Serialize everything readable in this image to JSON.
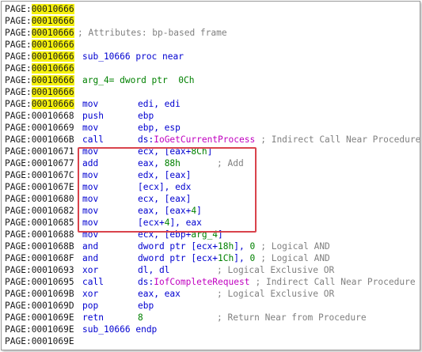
{
  "listing": {
    "rows": [
      {
        "prefix": "PAGE:",
        "addr": "00010666",
        "hl": true
      },
      {
        "prefix": "PAGE:",
        "addr": "00010666",
        "hl": true
      },
      {
        "prefix": "PAGE:",
        "addr": "00010666",
        "hl": true,
        "c": "; Attributes: bp-based frame",
        "ccolor": "gray",
        "cpos": "a"
      },
      {
        "prefix": "PAGE:",
        "addr": "00010666",
        "hl": true
      },
      {
        "prefix": "PAGE:",
        "addr": "00010666",
        "hl": true,
        "a": "sub_10666 proc near",
        "acolor": "blue"
      },
      {
        "prefix": "PAGE:",
        "addr": "00010666",
        "hl": true
      },
      {
        "prefix": "PAGE:",
        "addr": "00010666",
        "hl": true,
        "a": "arg_4= dword ptr  0Ch",
        "acolor": "green"
      },
      {
        "prefix": "PAGE:",
        "addr": "00010666",
        "hl": true
      },
      {
        "prefix": "PAGE:",
        "addr": "00010666",
        "hl": true,
        "a": "mov",
        "b": "edi, edi"
      },
      {
        "prefix": "PAGE:",
        "addr": "00010668",
        "a": "push",
        "b": "ebp"
      },
      {
        "prefix": "PAGE:",
        "addr": "00010669",
        "a": "mov",
        "b": "ebp, esp"
      },
      {
        "prefix": "PAGE:",
        "addr": "0001066B",
        "a": "call",
        "b": "ds:",
        "b2": "IoGetCurrentProcess",
        "b2color": "magenta",
        "c": " ; Indirect Call Near Procedure"
      },
      {
        "prefix": "PAGE:",
        "addr": "00010671",
        "a": "mov",
        "b": "ecx, [eax+",
        "b2": "8Ch",
        "b2color": "green",
        "b3": "]"
      },
      {
        "prefix": "PAGE:",
        "addr": "00010677",
        "a": "add",
        "b": "eax, ",
        "b2": "88h",
        "b2color": "green",
        "c": "; Add",
        "cgap": true
      },
      {
        "prefix": "PAGE:",
        "addr": "0001067C",
        "a": "mov",
        "b": "edx, [eax]"
      },
      {
        "prefix": "PAGE:",
        "addr": "0001067E",
        "a": "mov",
        "b": "[ecx], edx"
      },
      {
        "prefix": "PAGE:",
        "addr": "00010680",
        "a": "mov",
        "b": "ecx, [eax]"
      },
      {
        "prefix": "PAGE:",
        "addr": "00010682",
        "a": "mov",
        "b": "eax, [eax+",
        "b2": "4",
        "b2color": "green",
        "b3": "]"
      },
      {
        "prefix": "PAGE:",
        "addr": "00010685",
        "a": "mov",
        "b": "[ecx+",
        "b2": "4",
        "b2color": "green",
        "b3": "], eax"
      },
      {
        "prefix": "PAGE:",
        "addr": "00010688",
        "a": "mov",
        "b": "ecx, [ebp+",
        "b2": "arg_4",
        "b2color": "green",
        "b3": "]"
      },
      {
        "prefix": "PAGE:",
        "addr": "0001068B",
        "a": "and",
        "b": "dword ptr [ecx+",
        "b2": "18h",
        "b2color": "green",
        "b3": "], ",
        "b4": "0",
        "b4color": "green",
        "c": " ; Logical AND"
      },
      {
        "prefix": "PAGE:",
        "addr": "0001068F",
        "a": "and",
        "b": "dword ptr [ecx+",
        "b2": "1Ch",
        "b2color": "green",
        "b3": "], ",
        "b4": "0",
        "b4color": "green",
        "c": " ; Logical AND"
      },
      {
        "prefix": "PAGE:",
        "addr": "00010693",
        "a": "xor",
        "b": "dl, dl",
        "c": "; Logical Exclusive OR",
        "cgap": true
      },
      {
        "prefix": "PAGE:",
        "addr": "00010695",
        "a": "call",
        "b": "ds:",
        "b2": "IofCompleteRequest",
        "b2color": "magenta",
        "c": " ; Indirect Call Near Procedure"
      },
      {
        "prefix": "PAGE:",
        "addr": "0001069B",
        "a": "xor",
        "b": "eax, eax",
        "c": "; Logical Exclusive OR",
        "cgap": true
      },
      {
        "prefix": "PAGE:",
        "addr": "0001069D",
        "a": "pop",
        "b": "ebp"
      },
      {
        "prefix": "PAGE:",
        "addr": "0001069E",
        "a": "retn",
        "b": "8",
        "bcolor": "green",
        "c": "; Return Near from Procedure",
        "cgap": true
      },
      {
        "prefix": "PAGE:",
        "addr": "0001069E",
        "a": "sub_10666 endp",
        "acolor": "blue"
      },
      {
        "prefix": "PAGE:",
        "addr": "0001069E"
      }
    ]
  },
  "colors": {
    "address_highlight": "#f5f10d",
    "selection_box": "#d9434c",
    "mnemonic": "#0000d0",
    "comment": "#808080",
    "number": "#008000",
    "import": "#c000c0"
  }
}
